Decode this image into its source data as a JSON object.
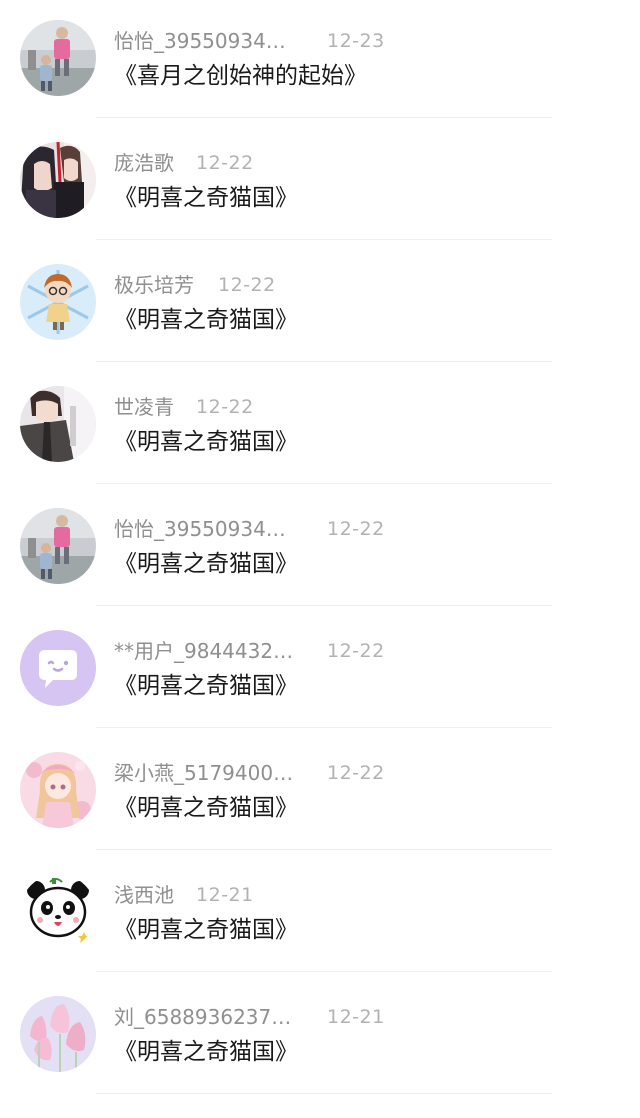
{
  "items": [
    {
      "name": "怡怡_39550934…",
      "date": "12-23",
      "title": "《喜月之创始神的起始》",
      "avatar": "photo-child-pink-icon"
    },
    {
      "name": "庞浩歌",
      "date": "12-22",
      "title": "《明喜之奇猫国》",
      "avatar": "anime-couple-icon"
    },
    {
      "name": "极乐培芳",
      "date": "12-22",
      "title": "《明喜之奇猫国》",
      "avatar": "chibi-glasses-boy-icon"
    },
    {
      "name": "世凌青",
      "date": "12-22",
      "title": "《明喜之奇猫国》",
      "avatar": "anime-boy-coat-icon"
    },
    {
      "name": "怡怡_39550934…",
      "date": "12-22",
      "title": "《明喜之奇猫国》",
      "avatar": "photo-child-pink-icon"
    },
    {
      "name": "**用户_9844432…",
      "date": "12-22",
      "title": "《明喜之奇猫国》",
      "avatar": "chat-bubble-face-icon"
    },
    {
      "name": "梁小燕_5179400…",
      "date": "12-22",
      "title": "《明喜之奇猫国》",
      "avatar": "anime-girl-pink-icon"
    },
    {
      "name": "浅西池",
      "date": "12-21",
      "title": "《明喜之奇猫国》",
      "avatar": "panda-icon"
    },
    {
      "name": "刘_6588936237…",
      "date": "12-21",
      "title": "《明喜之奇猫国》",
      "avatar": "tulips-icon"
    }
  ]
}
